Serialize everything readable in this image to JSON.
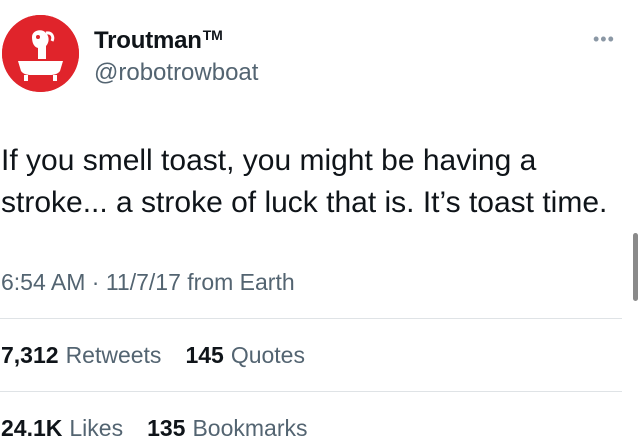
{
  "author": {
    "display_name": "Troutman",
    "trademark": "TM",
    "handle": "@robotrowboat"
  },
  "more_label": "•••",
  "tweet": {
    "text_line1": "If you smell toast, you might be having a",
    "text_line2": "stroke... a stroke of luck that is. It’s toast time."
  },
  "meta": {
    "time": "6:54 AM",
    "separator": "·",
    "date": "11/7/17",
    "source": "from Earth"
  },
  "stats": {
    "retweets_count": "7,312",
    "retweets_label": "Retweets",
    "quotes_count": "145",
    "quotes_label": "Quotes",
    "likes_count": "24.1K",
    "likes_label": "Likes",
    "bookmarks_count": "135",
    "bookmarks_label": "Bookmarks"
  },
  "colors": {
    "avatar_red": "#e0242b",
    "text_primary": "#0f1419",
    "text_secondary": "#536471",
    "divider": "#dfe3e6"
  }
}
